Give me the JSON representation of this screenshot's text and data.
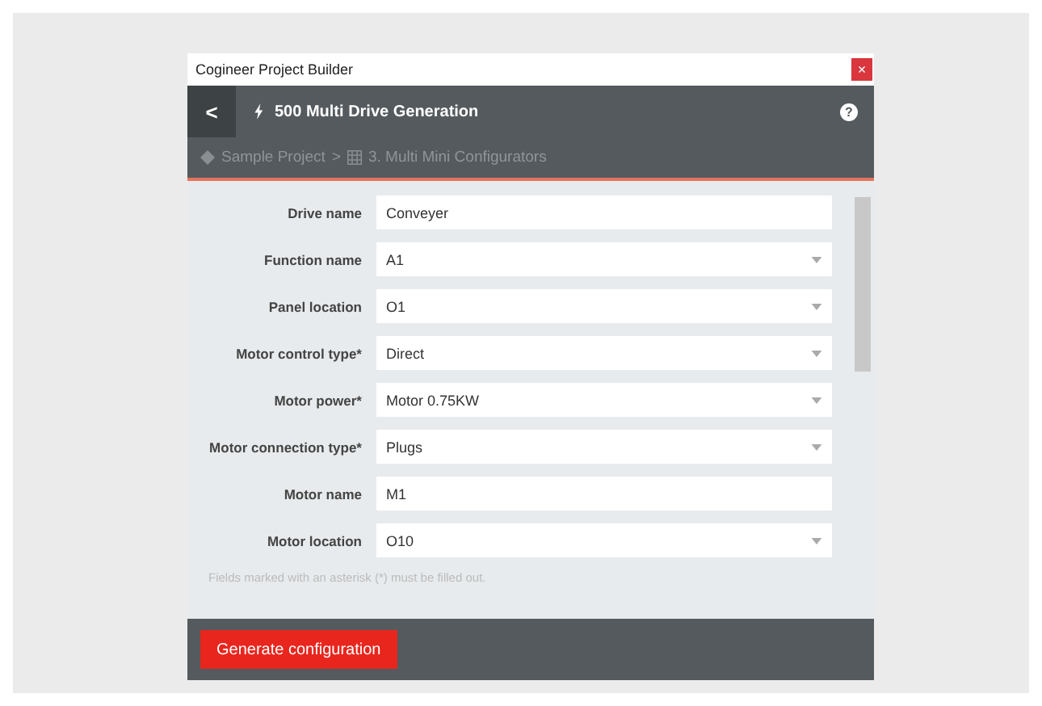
{
  "window": {
    "title": "Cogineer Project Builder",
    "close": "×"
  },
  "header": {
    "back": "<",
    "title": "500 Multi Drive Generation",
    "help": "?"
  },
  "breadcrumb": [
    {
      "kind": "project",
      "label": "Sample Project"
    },
    {
      "kind": "separator",
      "label": ">"
    },
    {
      "kind": "configurator",
      "label": "3. Multi Mini Configurators"
    }
  ],
  "fields": [
    {
      "label": "Drive name",
      "kind": "text",
      "value": "Conveyer"
    },
    {
      "label": "Function name",
      "kind": "select",
      "value": "A1"
    },
    {
      "label": "Panel location",
      "kind": "select",
      "value": "O1"
    },
    {
      "label": "Motor control type*",
      "kind": "select",
      "value": "Direct"
    },
    {
      "label": "Motor power*",
      "kind": "select",
      "value": "Motor 0.75KW"
    },
    {
      "label": "Motor connection type*",
      "kind": "select",
      "value": "Plugs"
    },
    {
      "label": "Motor name",
      "kind": "text",
      "value": "M1"
    },
    {
      "label": "Motor location",
      "kind": "select",
      "value": "O10"
    }
  ],
  "note": "Fields marked with an asterisk (*) must be filled out.",
  "footer": {
    "button": "Generate configuration"
  }
}
